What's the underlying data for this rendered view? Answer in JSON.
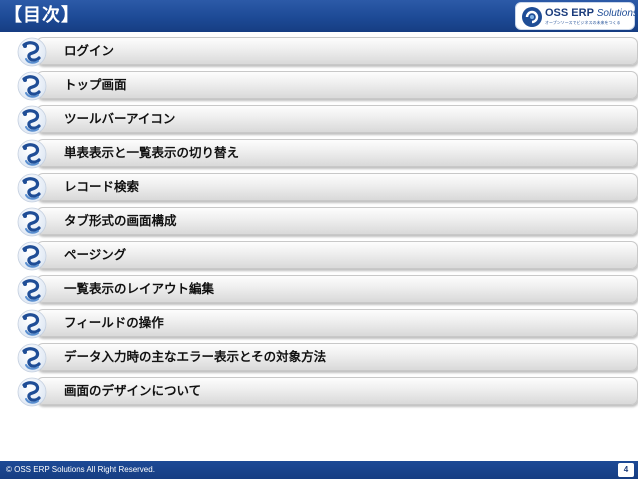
{
  "header": {
    "title": "【目次】",
    "brand_color": "#1d4a96"
  },
  "logo": {
    "name_main": "OSS ERP ",
    "name_sub": "Solutions",
    "tagline": "オープンソースでビジネスの未来をつくる"
  },
  "toc": {
    "items": [
      {
        "label": "ログイン"
      },
      {
        "label": "トップ画面"
      },
      {
        "label": "ツールバーアイコン"
      },
      {
        "label": "単表表示と一覧表示の切り替え"
      },
      {
        "label": "レコード検索"
      },
      {
        "label": "タブ形式の画面構成"
      },
      {
        "label": "ページング"
      },
      {
        "label": "一覧表示のレイアウト編集"
      },
      {
        "label": "フィールドの操作"
      },
      {
        "label": "データ入力時の主なエラー表示とその対象方法"
      },
      {
        "label": "画面のデザインについて"
      }
    ],
    "icon": "swirl-bullet-icon"
  },
  "footer": {
    "copyright": "© OSS ERP Solutions All Right Reserved.",
    "page_number": "4"
  }
}
